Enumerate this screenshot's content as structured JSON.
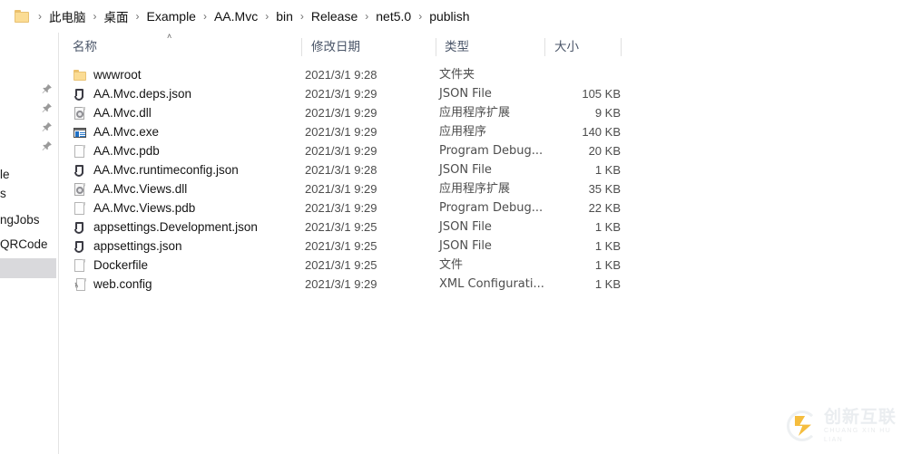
{
  "breadcrumb": {
    "folder_icon": "folder-icon",
    "separator": "›",
    "items": [
      {
        "label": "此电脑",
        "cjk": true
      },
      {
        "label": "桌面",
        "cjk": true
      },
      {
        "label": "Example",
        "cjk": false
      },
      {
        "label": "AA.Mvc",
        "cjk": false
      },
      {
        "label": "bin",
        "cjk": false
      },
      {
        "label": "Release",
        "cjk": false
      },
      {
        "label": "net5.0",
        "cjk": false
      },
      {
        "label": "publish",
        "cjk": false
      }
    ]
  },
  "sidebar": {
    "pins": [
      "pin-icon",
      "pin-icon",
      "pin-icon",
      "pin-icon"
    ],
    "clipped_items": [
      {
        "label": "le"
      },
      {
        "label": "s"
      },
      {
        "label": "ngJobs"
      },
      {
        "label": "QRCode"
      }
    ]
  },
  "columns": {
    "name": "名称",
    "date_modified": "修改日期",
    "type": "类型",
    "size": "大小",
    "sort_caret": "˄"
  },
  "files": [
    {
      "name": "wwwroot",
      "icon": "folder",
      "date": "2021/3/1 9:28",
      "type": "文件夹",
      "size": ""
    },
    {
      "name": "AA.Mvc.deps.json",
      "icon": "json",
      "date": "2021/3/1 9:29",
      "type": "JSON File",
      "size": "105 KB"
    },
    {
      "name": "AA.Mvc.dll",
      "icon": "dll",
      "date": "2021/3/1 9:29",
      "type": "应用程序扩展",
      "size": "9 KB"
    },
    {
      "name": "AA.Mvc.exe",
      "icon": "exe",
      "date": "2021/3/1 9:29",
      "type": "应用程序",
      "size": "140 KB"
    },
    {
      "name": "AA.Mvc.pdb",
      "icon": "page",
      "date": "2021/3/1 9:29",
      "type": "Program Debug...",
      "size": "20 KB"
    },
    {
      "name": "AA.Mvc.runtimeconfig.json",
      "icon": "json",
      "date": "2021/3/1 9:28",
      "type": "JSON File",
      "size": "1 KB"
    },
    {
      "name": "AA.Mvc.Views.dll",
      "icon": "dll",
      "date": "2021/3/1 9:29",
      "type": "应用程序扩展",
      "size": "35 KB"
    },
    {
      "name": "AA.Mvc.Views.pdb",
      "icon": "page",
      "date": "2021/3/1 9:29",
      "type": "Program Debug...",
      "size": "22 KB"
    },
    {
      "name": "appsettings.Development.json",
      "icon": "json",
      "date": "2021/3/1 9:25",
      "type": "JSON File",
      "size": "1 KB"
    },
    {
      "name": "appsettings.json",
      "icon": "json",
      "date": "2021/3/1 9:25",
      "type": "JSON File",
      "size": "1 KB"
    },
    {
      "name": "Dockerfile",
      "icon": "page",
      "date": "2021/3/1 9:25",
      "type": "文件",
      "size": "1 KB"
    },
    {
      "name": "web.config",
      "icon": "cfg",
      "date": "2021/3/1 9:29",
      "type": "XML Configurati...",
      "size": "1 KB"
    }
  ],
  "watermark": {
    "title": "创新互联",
    "subtitle": "CHUANG XIN HU LIAN",
    "accent_color": "#f5b82e"
  }
}
